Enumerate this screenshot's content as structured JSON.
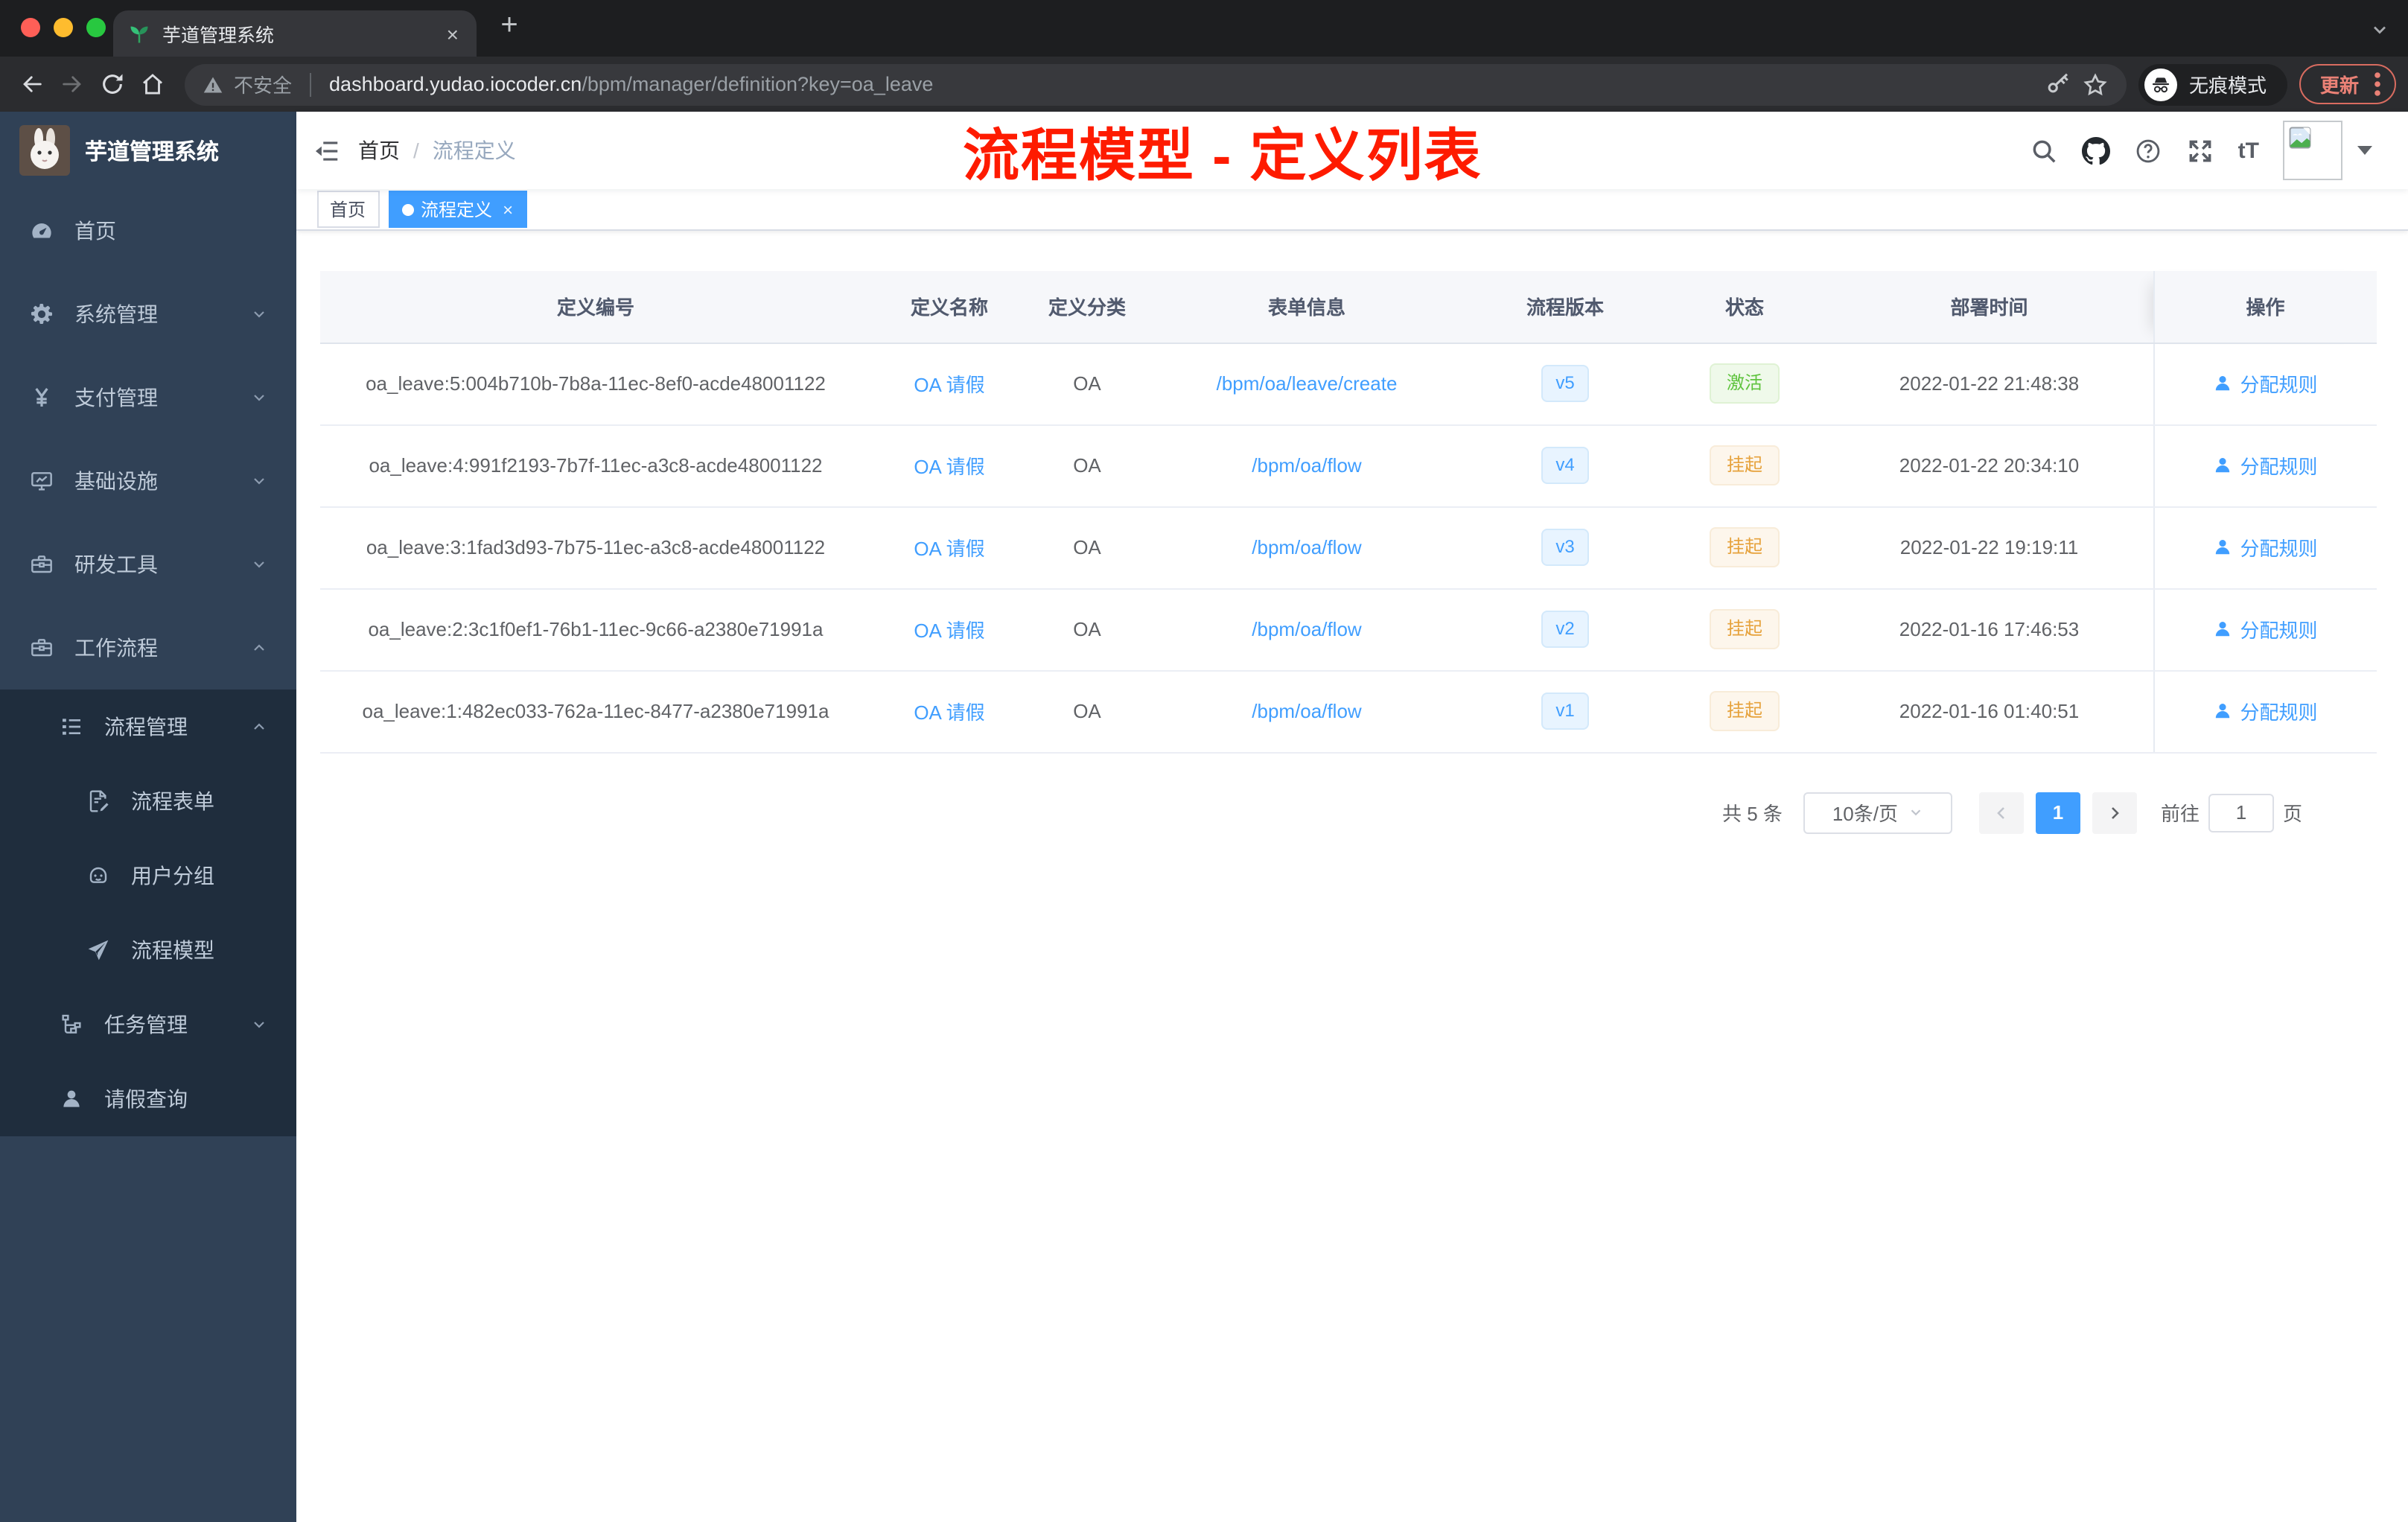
{
  "colors": {
    "accent": "#409eff",
    "sidebar_bg": "#304156",
    "submenu_bg": "#1f2d3d",
    "annotation_red": "#fe1b00",
    "status_active_green": "#5fc33e",
    "status_suspend_orange": "#e6a23c",
    "update_button_red": "#ea8176"
  },
  "browser": {
    "tab_title": "芋道管理系统",
    "security_label": "不安全",
    "url_host": "dashboard.yudao.iocoder.cn",
    "url_path": "/bpm/manager/definition?key=oa_leave",
    "incognito_label": "无痕模式",
    "update_label": "更新"
  },
  "sidebar": {
    "logo_title": "芋道管理系统",
    "menu": [
      {
        "key": "home",
        "label": "首页",
        "icon": "dashboard-icon",
        "level": 0,
        "chevron": null,
        "dark": false
      },
      {
        "key": "system-manage",
        "label": "系统管理",
        "icon": "gear-icon",
        "level": 0,
        "chevron": "down",
        "dark": false
      },
      {
        "key": "payment-manage",
        "label": "支付管理",
        "icon": "yen-icon",
        "level": 0,
        "chevron": "down",
        "dark": false
      },
      {
        "key": "infrastructure",
        "label": "基础设施",
        "icon": "monitor-icon",
        "level": 0,
        "chevron": "down",
        "dark": false
      },
      {
        "key": "dev-tools",
        "label": "研发工具",
        "icon": "toolbox-icon",
        "level": 0,
        "chevron": "down",
        "dark": false
      },
      {
        "key": "workflow",
        "label": "工作流程",
        "icon": "briefcase-icon",
        "level": 0,
        "chevron": "up",
        "dark": false
      },
      {
        "key": "process-manage",
        "label": "流程管理",
        "icon": "list-icon",
        "level": 1,
        "chevron": "up",
        "dark": true
      },
      {
        "key": "process-form",
        "label": "流程表单",
        "icon": "form-icon",
        "level": 2,
        "chevron": null,
        "dark": true
      },
      {
        "key": "user-group",
        "label": "用户分组",
        "icon": "group-icon",
        "level": 2,
        "chevron": null,
        "dark": true
      },
      {
        "key": "process-model",
        "label": "流程模型",
        "icon": "paper-plane-icon",
        "level": 2,
        "chevron": null,
        "dark": true
      },
      {
        "key": "task-manage",
        "label": "任务管理",
        "icon": "tree-icon",
        "level": 1,
        "chevron": "down",
        "dark": true
      },
      {
        "key": "leave-query",
        "label": "请假查询",
        "icon": "user-icon",
        "level": 1,
        "chevron": null,
        "dark": true
      }
    ]
  },
  "header": {
    "breadcrumb": {
      "home": "首页",
      "separator": "/",
      "current": "流程定义"
    },
    "annotation": "流程模型 - 定义列表",
    "font_size_label": "tT"
  },
  "tags": [
    {
      "key": "home",
      "label": "首页",
      "active": false
    },
    {
      "key": "process-definition",
      "label": "流程定义",
      "active": true
    }
  ],
  "table": {
    "columns": [
      "定义编号",
      "定义名称",
      "定义分类",
      "表单信息",
      "流程版本",
      "状态",
      "部署时间",
      "操作"
    ],
    "action_label": "分配规则",
    "rows": [
      {
        "id": "oa_leave:5:004b710b-7b8a-11ec-8ef0-acde48001122",
        "name": "OA 请假",
        "category": "OA",
        "form": "/bpm/oa/leave/create",
        "version": "v5",
        "status": "激活",
        "status_type": "success",
        "deployed": "2022-01-22 21:48:38"
      },
      {
        "id": "oa_leave:4:991f2193-7b7f-11ec-a3c8-acde48001122",
        "name": "OA 请假",
        "category": "OA",
        "form": "/bpm/oa/flow",
        "version": "v4",
        "status": "挂起",
        "status_type": "warning",
        "deployed": "2022-01-22 20:34:10"
      },
      {
        "id": "oa_leave:3:1fad3d93-7b75-11ec-a3c8-acde48001122",
        "name": "OA 请假",
        "category": "OA",
        "form": "/bpm/oa/flow",
        "version": "v3",
        "status": "挂起",
        "status_type": "warning",
        "deployed": "2022-01-22 19:19:11"
      },
      {
        "id": "oa_leave:2:3c1f0ef1-76b1-11ec-9c66-a2380e71991a",
        "name": "OA 请假",
        "category": "OA",
        "form": "/bpm/oa/flow",
        "version": "v2",
        "status": "挂起",
        "status_type": "warning",
        "deployed": "2022-01-16 17:46:53"
      },
      {
        "id": "oa_leave:1:482ec033-762a-11ec-8477-a2380e71991a",
        "name": "OA 请假",
        "category": "OA",
        "form": "/bpm/oa/flow",
        "version": "v1",
        "status": "挂起",
        "status_type": "warning",
        "deployed": "2022-01-16 01:40:51"
      }
    ]
  },
  "pagination": {
    "total": "共 5 条",
    "page_size": "10条/页",
    "page": "1",
    "goto_label": "前往",
    "page_unit": "页",
    "goto_value": "1"
  }
}
